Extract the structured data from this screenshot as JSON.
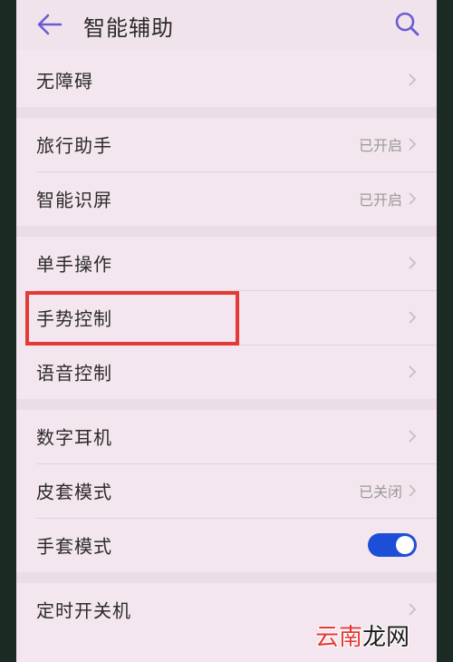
{
  "header": {
    "title": "智能辅助",
    "back_icon": "arrow-left-icon",
    "search_icon": "search-icon"
  },
  "items": [
    {
      "label": "无障碍",
      "status": ""
    },
    {
      "label": "旅行助手",
      "status": "已开启"
    },
    {
      "label": "智能识屏",
      "status": "已开启"
    },
    {
      "label": "单手操作",
      "status": ""
    },
    {
      "label": "手势控制",
      "status": ""
    },
    {
      "label": "语音控制",
      "status": ""
    },
    {
      "label": "数字耳机",
      "status": ""
    },
    {
      "label": "皮套模式",
      "status": "已关闭"
    },
    {
      "label": "手套模式",
      "status": "",
      "toggle_on": true
    },
    {
      "label": "定时开关机",
      "status": ""
    }
  ],
  "colors": {
    "accent": "#1d4ed8",
    "highlight": "#e53935",
    "icon": "#6b5bd6"
  },
  "watermark": {
    "part1": "云南",
    "part2": "龙网"
  }
}
